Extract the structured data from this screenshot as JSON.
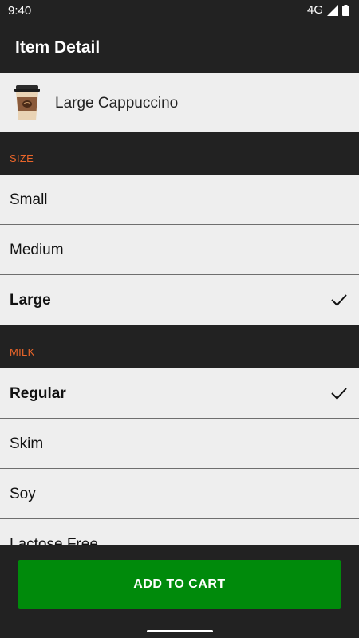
{
  "status_bar": {
    "time": "9:40",
    "network": "4G",
    "icons": [
      "signal-icon",
      "battery-icon"
    ]
  },
  "app_bar": {
    "title": "Item Detail"
  },
  "item": {
    "name": "Large Cappuccino",
    "icon": "coffee-cup-icon"
  },
  "sections": [
    {
      "label": "SIZE",
      "options": [
        {
          "label": "Small",
          "selected": false
        },
        {
          "label": "Medium",
          "selected": false
        },
        {
          "label": "Large",
          "selected": true
        }
      ]
    },
    {
      "label": "MILK",
      "options": [
        {
          "label": "Regular",
          "selected": true
        },
        {
          "label": "Skim",
          "selected": false
        },
        {
          "label": "Soy",
          "selected": false
        },
        {
          "label": "Lactose Free",
          "selected": false
        }
      ]
    }
  ],
  "cart_button": {
    "label": "ADD TO CART"
  },
  "colors": {
    "accent": "#e8652a",
    "button": "#008a0b",
    "background": "#222222",
    "row": "#eeeeee"
  }
}
